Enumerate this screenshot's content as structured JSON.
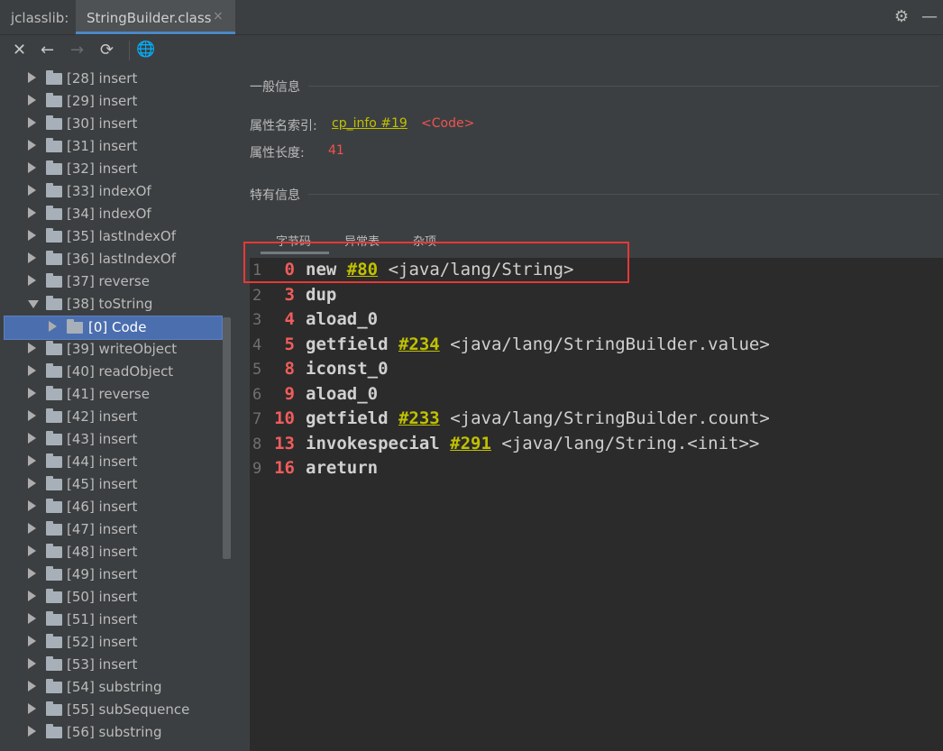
{
  "window": {
    "plugin_label": "jclasslib:",
    "tab_title": "StringBuilder.class",
    "tab_close": "×",
    "settings_icon": "gear-icon",
    "minimize_icon": "minimize-icon"
  },
  "toolbar": {
    "close": "✕",
    "back": "←",
    "forward": "→",
    "refresh": "⟳",
    "browser": "🌐"
  },
  "tree": {
    "items": [
      {
        "label": "[28] insert",
        "expanded": false,
        "level": 0
      },
      {
        "label": "[29] insert",
        "expanded": false,
        "level": 0
      },
      {
        "label": "[30] insert",
        "expanded": false,
        "level": 0
      },
      {
        "label": "[31] insert",
        "expanded": false,
        "level": 0
      },
      {
        "label": "[32] insert",
        "expanded": false,
        "level": 0
      },
      {
        "label": "[33] indexOf",
        "expanded": false,
        "level": 0
      },
      {
        "label": "[34] indexOf",
        "expanded": false,
        "level": 0
      },
      {
        "label": "[35] lastIndexOf",
        "expanded": false,
        "level": 0
      },
      {
        "label": "[36] lastIndexOf",
        "expanded": false,
        "level": 0
      },
      {
        "label": "[37] reverse",
        "expanded": false,
        "level": 0
      },
      {
        "label": "[38] toString",
        "expanded": true,
        "level": 0
      },
      {
        "label": "[0] Code",
        "expanded": false,
        "level": 1,
        "selected": true
      },
      {
        "label": "[39] writeObject",
        "expanded": false,
        "level": 0
      },
      {
        "label": "[40] readObject",
        "expanded": false,
        "level": 0
      },
      {
        "label": "[41] reverse",
        "expanded": false,
        "level": 0
      },
      {
        "label": "[42] insert",
        "expanded": false,
        "level": 0
      },
      {
        "label": "[43] insert",
        "expanded": false,
        "level": 0
      },
      {
        "label": "[44] insert",
        "expanded": false,
        "level": 0
      },
      {
        "label": "[45] insert",
        "expanded": false,
        "level": 0
      },
      {
        "label": "[46] insert",
        "expanded": false,
        "level": 0
      },
      {
        "label": "[47] insert",
        "expanded": false,
        "level": 0
      },
      {
        "label": "[48] insert",
        "expanded": false,
        "level": 0
      },
      {
        "label": "[49] insert",
        "expanded": false,
        "level": 0
      },
      {
        "label": "[50] insert",
        "expanded": false,
        "level": 0
      },
      {
        "label": "[51] insert",
        "expanded": false,
        "level": 0
      },
      {
        "label": "[52] insert",
        "expanded": false,
        "level": 0
      },
      {
        "label": "[53] insert",
        "expanded": false,
        "level": 0
      },
      {
        "label": "[54] substring",
        "expanded": false,
        "level": 0
      },
      {
        "label": "[55] subSequence",
        "expanded": false,
        "level": 0
      },
      {
        "label": "[56] substring",
        "expanded": false,
        "level": 0
      }
    ]
  },
  "general": {
    "title": "一般信息",
    "name_index_label": "属性名索引:",
    "name_index_link": "cp_info #19",
    "name_index_value": "<Code>",
    "length_label": "属性长度:",
    "length_value": "41"
  },
  "specific": {
    "title": "特有信息",
    "tabs": [
      "字节码",
      "异常表",
      "杂项"
    ]
  },
  "bytecode": [
    {
      "line": "1",
      "offset": "0",
      "instr": "new",
      "ref": "#80",
      "comment": "<java/lang/String>"
    },
    {
      "line": "2",
      "offset": "3",
      "instr": "dup",
      "ref": "",
      "comment": ""
    },
    {
      "line": "3",
      "offset": "4",
      "instr": "aload_0",
      "ref": "",
      "comment": ""
    },
    {
      "line": "4",
      "offset": "5",
      "instr": "getfield",
      "ref": "#234",
      "comment": "<java/lang/StringBuilder.value>"
    },
    {
      "line": "5",
      "offset": "8",
      "instr": "iconst_0",
      "ref": "",
      "comment": ""
    },
    {
      "line": "6",
      "offset": "9",
      "instr": "aload_0",
      "ref": "",
      "comment": ""
    },
    {
      "line": "7",
      "offset": "10",
      "instr": "getfield",
      "ref": "#233",
      "comment": "<java/lang/StringBuilder.count>"
    },
    {
      "line": "8",
      "offset": "13",
      "instr": "invokespecial",
      "ref": "#291",
      "comment": "<java/lang/String.<init>>"
    },
    {
      "line": "9",
      "offset": "16",
      "instr": "areturn",
      "ref": "",
      "comment": ""
    }
  ]
}
